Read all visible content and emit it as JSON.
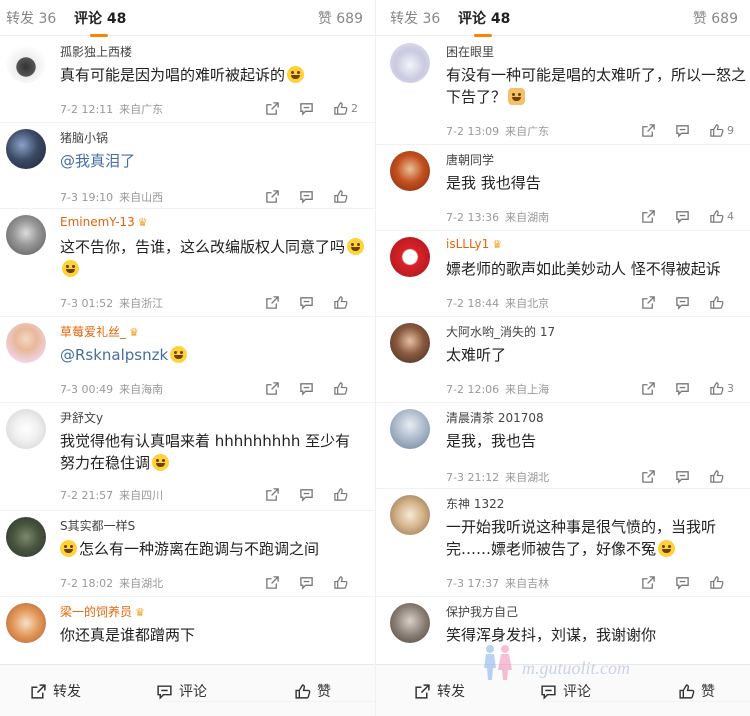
{
  "tabs": {
    "repost": "转发 36",
    "comment": "评论 48",
    "like": "赞 689"
  },
  "bottom": {
    "repost": "转发",
    "comment": "评论",
    "like": "赞"
  },
  "watermark": "m.gutuolit.com",
  "left": [
    {
      "user": "孤影独上西楼",
      "vip": false,
      "text": "真有可能是因为唱的难听被起诉的",
      "emoji": true,
      "time": "7-2 12:11",
      "loc": "来自广东",
      "likes": "2"
    },
    {
      "user": "猪脑小锅",
      "vip": false,
      "mention": "@我真泪了",
      "text": "",
      "time": "7-3 19:10",
      "loc": "来自山西",
      "likes": ""
    },
    {
      "user": "EminemY-13",
      "vip": true,
      "text": "这不告你，告谁，这么改编版权人同意了吗",
      "emoji2": true,
      "time": "7-3 01:52",
      "loc": "来自浙江",
      "likes": ""
    },
    {
      "user": "草莓爱礼丝_",
      "vip": true,
      "mention": "@Rsknalpsnzk",
      "text": "",
      "emoji": true,
      "time": "7-3 00:49",
      "loc": "来自海南",
      "likes": ""
    },
    {
      "user": "尹舒文y",
      "vip": false,
      "text": "我觉得他有认真唱来着 hhhhhhhhh 至少有努力在稳住调",
      "emoji": true,
      "time": "7-2 21:57",
      "loc": "来自四川",
      "likes": ""
    },
    {
      "user": "S其实都一样S",
      "vip": false,
      "text": "怎么有一种游离在跑调与不跑调之间",
      "emojiLead": true,
      "time": "7-2 18:02",
      "loc": "来自湖北",
      "likes": ""
    },
    {
      "user": "梁一的饲养员",
      "vip": true,
      "text": "你还真是谁都蹭两下",
      "time": "",
      "loc": "",
      "likes": ""
    }
  ],
  "right": [
    {
      "user": "困在眼里",
      "vip": false,
      "text": "有没有一种可能是唱的太难听了，所以一怒之下告了？",
      "emojiDog": true,
      "time": "7-2 13:09",
      "loc": "来自广东",
      "likes": "9"
    },
    {
      "user": "唐朝同学",
      "vip": false,
      "text": "是我 我也得告",
      "time": "7-2 13:36",
      "loc": "来自湖南",
      "likes": "4"
    },
    {
      "user": "isLLLy1",
      "vip": true,
      "text": "嫖老师的歌声如此美妙动人 怪不得被起诉",
      "time": "7-2 18:44",
      "loc": "来自北京",
      "likes": ""
    },
    {
      "user": "大阿水哟_消失的 17",
      "vip": false,
      "text": "太难听了",
      "time": "7-2 12:06",
      "loc": "来自上海",
      "likes": "3"
    },
    {
      "user": "清晨清茶 201708",
      "vip": false,
      "text": "是我，我也告",
      "time": "7-3 21:12",
      "loc": "来自湖北",
      "likes": ""
    },
    {
      "user": "东神 1322",
      "vip": false,
      "text": "一开始我听说这种事是很气愤的，当我听完……嫖老师被告了，好像不冤",
      "emoji": true,
      "time": "7-3 17:37",
      "loc": "来自吉林",
      "likes": ""
    },
    {
      "user": "保护我方自己",
      "vip": false,
      "text": "笑得浑身发抖，刘谋，我谢谢你",
      "time": "",
      "loc": "",
      "likes": ""
    }
  ]
}
